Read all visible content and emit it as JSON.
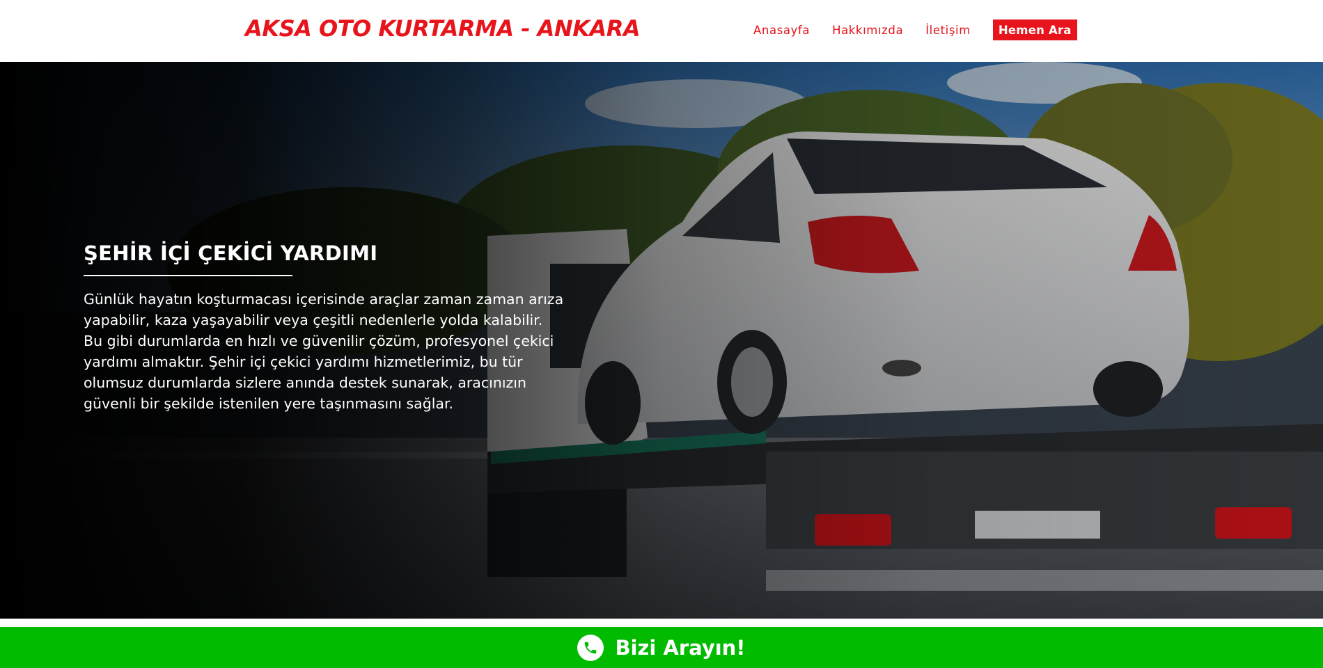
{
  "header": {
    "logo": "AKSA OTO KURTARMA - ANKARA",
    "nav": {
      "home": "Anasayfa",
      "about": "Hakkımızda",
      "contact": "İletişim",
      "cta": "Hemen Ara"
    }
  },
  "hero": {
    "title": "ŞEHİR İÇİ ÇEKİCİ YARDIMI",
    "body": "Günlük hayatın koşturmacası içerisinde araçlar zaman zaman arıza yapabilir, kaza yaşayabilir veya çeşitli nedenlerle yolda kalabilir. Bu gibi durumlarda en hızlı ve güvenilir çözüm, profesyonel çekici yardımı almaktır. Şehir içi çekici yardımı hizmetlerimiz, bu tür olumsuz durumlarda sizlere anında destek sunarak, aracınızın güvenli bir şekilde istenilen yere taşınmasını sağlar.",
    "image": "tow-truck-carrying-white-car"
  },
  "callbar": {
    "label": "Bizi Arayın!",
    "icon": "phone-icon"
  },
  "colors": {
    "brand_red": "#e8141b",
    "call_green": "#00bb00"
  }
}
